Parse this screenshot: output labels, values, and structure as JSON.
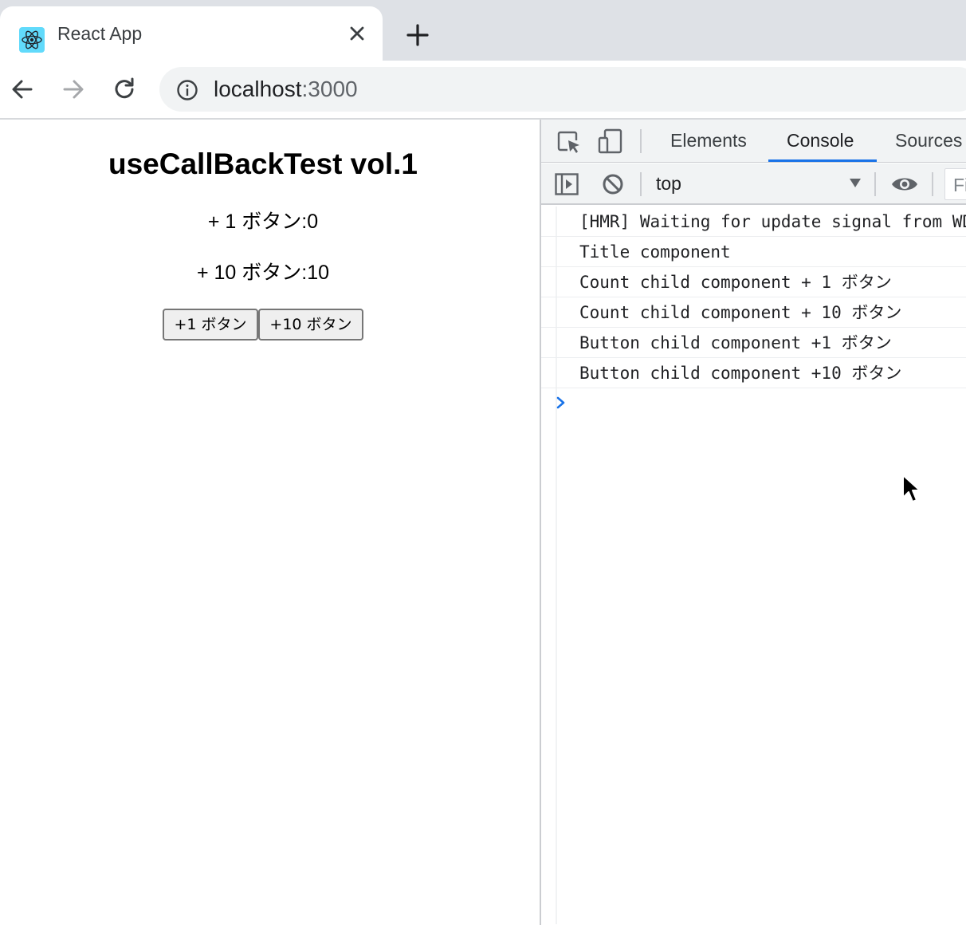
{
  "browser": {
    "tab": {
      "title": "React App",
      "favicon": "react-logo-icon",
      "close_icon": "close-icon"
    },
    "new_tab_icon": "plus-icon",
    "toolbar": {
      "back_icon": "arrow-left-icon",
      "forward_icon": "arrow-right-icon",
      "reload_icon": "reload-icon",
      "info_icon": "info-icon",
      "url_host": "localhost",
      "url_port": ":3000"
    }
  },
  "page": {
    "title": "useCallBackTest vol.1",
    "count_one": "+ 1 ボタン:0",
    "count_ten": "+ 10 ボタン:10",
    "buttons": {
      "plus_one": "+1 ボタン",
      "plus_ten": "+10 ボタン"
    }
  },
  "devtools": {
    "icons": {
      "inspect": "inspect-element-icon",
      "device": "device-toolbar-icon"
    },
    "tabs": [
      {
        "label": "Elements"
      },
      {
        "label": "Console",
        "active": true
      },
      {
        "label": "Sources"
      }
    ],
    "console_bar": {
      "sidebar_icon": "console-sidebar-icon",
      "clear_icon": "clear-console-icon",
      "context": "top",
      "dropdown_icon": "triangle-down-icon",
      "eye_icon": "eye-icon",
      "filter_placeholder": "Fi"
    },
    "messages": [
      "[HMR] Waiting for update signal from WDS...",
      "Title component",
      "Count child component + 1 ボタン",
      "Count child component + 10 ボタン",
      "Button child component +1 ボタン",
      "Button child component +10 ボタン"
    ],
    "prompt_icon": "chevron-right-icon"
  },
  "colors": {
    "tabstrip": "#dee1e6",
    "omnibox": "#f1f3f4",
    "accent": "#1a73e8",
    "react": "#61dafb"
  }
}
